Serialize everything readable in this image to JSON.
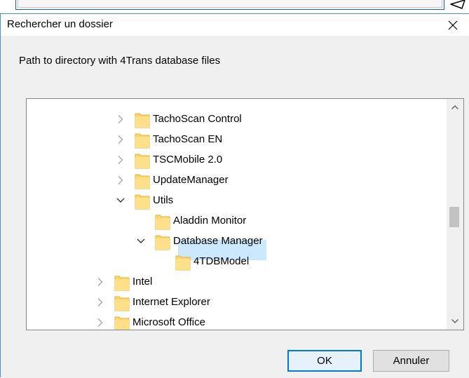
{
  "dialog": {
    "title": "Rechercher un dossier",
    "description": "Path to directory with 4Trans database files"
  },
  "tree": {
    "items": [
      {
        "label": "TachoScan Control",
        "level": 3,
        "expander": "collapsed"
      },
      {
        "label": "TachoScan EN",
        "level": 3,
        "expander": "collapsed"
      },
      {
        "label": "TSCMobile 2.0",
        "level": 3,
        "expander": "collapsed"
      },
      {
        "label": "UpdateManager",
        "level": 3,
        "expander": "collapsed"
      },
      {
        "label": "Utils",
        "level": 3,
        "expander": "expanded"
      },
      {
        "label": "Aladdin Monitor",
        "level": 4,
        "expander": "none"
      },
      {
        "label": "Database Manager",
        "level": 4,
        "expander": "expanded"
      },
      {
        "label": "4TDBModel",
        "level": 5,
        "expander": "none",
        "selected": true
      },
      {
        "label": "Intel",
        "level": 2,
        "expander": "collapsed"
      },
      {
        "label": "Internet Explorer",
        "level": 2,
        "expander": "collapsed"
      },
      {
        "label": "Microsoft Office",
        "level": 2,
        "expander": "collapsed"
      },
      {
        "label": "",
        "level": 2,
        "expander": "collapsed"
      }
    ],
    "selected_color": "#cce8ff",
    "folder_color": "#ffd665"
  },
  "buttons": {
    "ok": "OK",
    "cancel": "Annuler"
  },
  "accent_color": "#0078d7"
}
